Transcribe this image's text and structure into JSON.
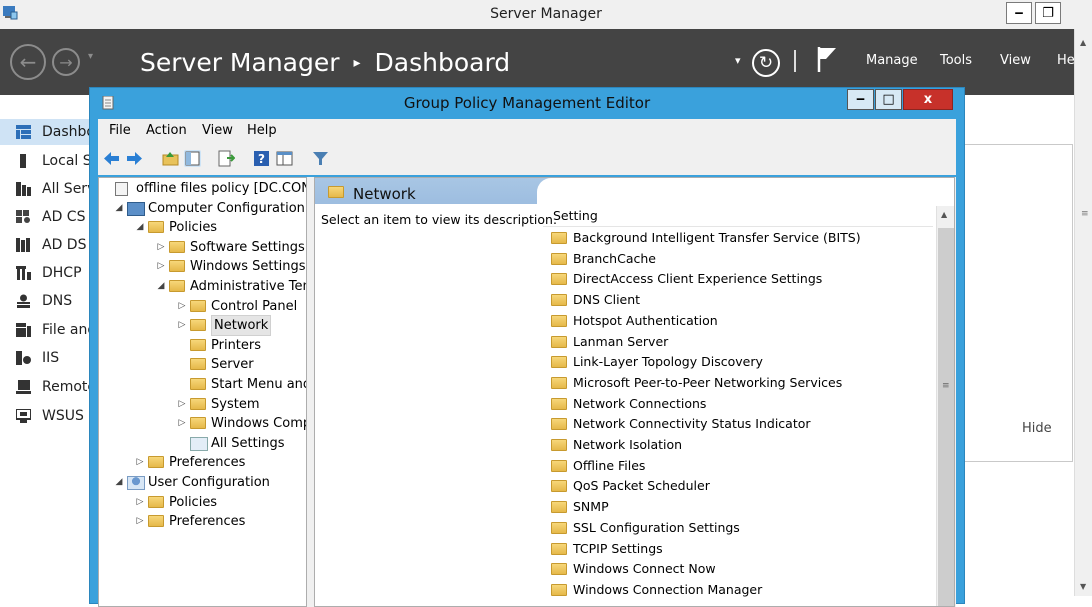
{
  "server_manager": {
    "window_title": "Server Manager",
    "breadcrumb_root": "Server Manager",
    "breadcrumb_separator": "▸",
    "breadcrumb_page": "Dashboard",
    "nav_back_glyph": "←",
    "nav_forward_glyph": "→",
    "refresh_glyph": "↻",
    "menu": [
      "Manage",
      "Tools",
      "View",
      "He"
    ],
    "window_buttons": {
      "minimize": "‒",
      "restore": "❐"
    },
    "sidebar": [
      {
        "label": "Dashbo",
        "icon": "dashboard-icon",
        "active": true
      },
      {
        "label": "Local S",
        "icon": "local-server-icon",
        "active": false
      },
      {
        "label": "All Serv",
        "icon": "all-servers-icon",
        "active": false
      },
      {
        "label": "AD CS",
        "icon": "ad-cs-icon",
        "active": false
      },
      {
        "label": "AD DS",
        "icon": "ad-ds-icon",
        "active": false
      },
      {
        "label": "DHCP",
        "icon": "dhcp-icon",
        "active": false
      },
      {
        "label": "DNS",
        "icon": "dns-icon",
        "active": false
      },
      {
        "label": "File and",
        "icon": "file-storage-icon",
        "active": false
      },
      {
        "label": "IIS",
        "icon": "iis-icon",
        "active": false
      },
      {
        "label": "Remote",
        "icon": "remote-access-icon",
        "active": false
      },
      {
        "label": "WSUS",
        "icon": "wsus-icon",
        "active": false
      }
    ],
    "hide_label": "Hide"
  },
  "gpme": {
    "title": "Group Policy Management Editor",
    "window_buttons": {
      "minimize": "‒",
      "maximize": "□",
      "close": "x"
    },
    "menu": [
      "File",
      "Action",
      "View",
      "Help"
    ],
    "tree": [
      {
        "label": "offline files policy [DC.CONTOS",
        "level": 0,
        "arrow": "",
        "icon": "gpo-icon"
      },
      {
        "label": "Computer Configuration",
        "level": 1,
        "arrow": "◢",
        "icon": "computer-icon"
      },
      {
        "label": "Policies",
        "level": 2,
        "arrow": "◢",
        "icon": "folder-icon"
      },
      {
        "label": "Software Settings",
        "level": 3,
        "arrow": "▷",
        "icon": "folder-icon"
      },
      {
        "label": "Windows Settings",
        "level": 3,
        "arrow": "▷",
        "icon": "folder-icon"
      },
      {
        "label": "Administrative Temp",
        "level": 3,
        "arrow": "◢",
        "icon": "folder-icon"
      },
      {
        "label": "Control Panel",
        "level": 4,
        "arrow": "▷",
        "icon": "folder-icon"
      },
      {
        "label": "Network",
        "level": 4,
        "arrow": "▷",
        "icon": "folder-icon",
        "selected": true
      },
      {
        "label": "Printers",
        "level": 4,
        "arrow": "",
        "icon": "folder-icon"
      },
      {
        "label": "Server",
        "level": 4,
        "arrow": "",
        "icon": "folder-icon"
      },
      {
        "label": "Start Menu and T",
        "level": 4,
        "arrow": "",
        "icon": "folder-icon"
      },
      {
        "label": "System",
        "level": 4,
        "arrow": "▷",
        "icon": "folder-icon"
      },
      {
        "label": "Windows Compo",
        "level": 4,
        "arrow": "▷",
        "icon": "folder-icon"
      },
      {
        "label": "All Settings",
        "level": 4,
        "arrow": "",
        "icon": "all-settings-icon"
      },
      {
        "label": "Preferences",
        "level": 2,
        "arrow": "▷",
        "icon": "folder-icon"
      },
      {
        "label": "User Configuration",
        "level": 1,
        "arrow": "◢",
        "icon": "user-icon"
      },
      {
        "label": "Policies",
        "level": 2,
        "arrow": "▷",
        "icon": "folder-icon"
      },
      {
        "label": "Preferences",
        "level": 2,
        "arrow": "▷",
        "icon": "folder-icon"
      }
    ],
    "content_title": "Network",
    "description_prompt": "Select an item to view its description.",
    "list_header": "Setting",
    "settings": [
      "Background Intelligent Transfer Service (BITS)",
      "BranchCache",
      "DirectAccess Client Experience Settings",
      "DNS Client",
      "Hotspot Authentication",
      "Lanman Server",
      "Link-Layer Topology Discovery",
      "Microsoft Peer-to-Peer Networking Services",
      "Network Connections",
      "Network Connectivity Status Indicator",
      "Network Isolation",
      "Offline Files",
      "QoS Packet Scheduler",
      "SNMP",
      "SSL Configuration Settings",
      "TCPIP Settings",
      "Windows Connect Now",
      "Windows Connection Manager"
    ]
  }
}
